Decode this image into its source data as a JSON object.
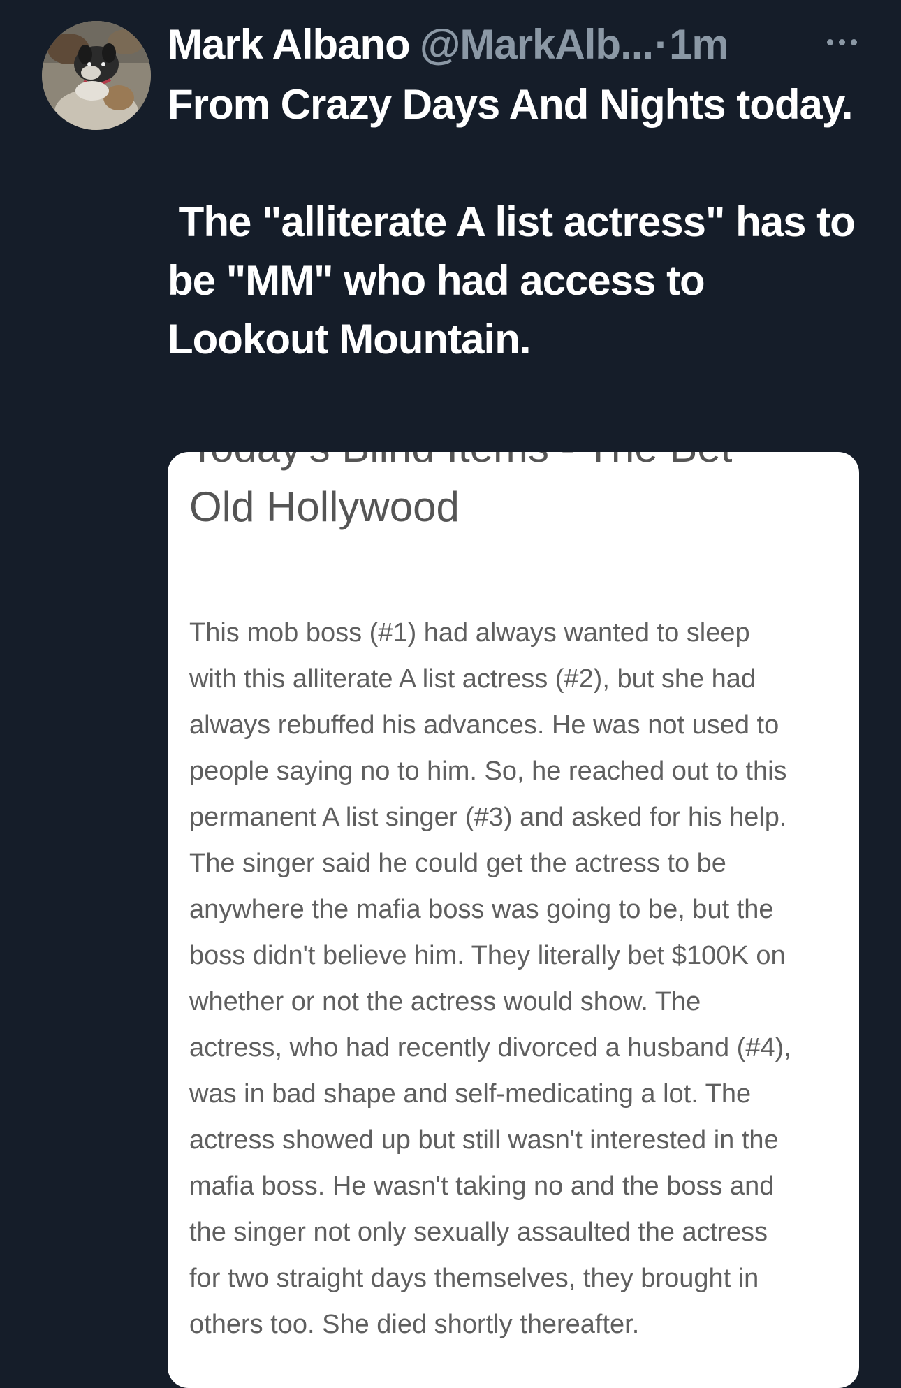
{
  "tweet": {
    "author_name": "Mark Albano",
    "author_handle": "@MarkAlb...",
    "separator": "·",
    "timestamp": "1m",
    "avatar_icon": "dog-avatar-icon",
    "more_icon": "more-horizontal-icon",
    "text_para1": "From Crazy Days And Nights today.",
    "text_para2": " The \"alliterate A list actress\" has to be \"MM\" who had access to Lookout Mountain."
  },
  "media": {
    "clipped_title": "Today's Blind Items - The Bet",
    "title": "Old Hollywood",
    "body_lines": [
      "This mob boss (#1) had always wanted to sleep",
      "with this alliterate A list actress (#2), but she had",
      "always rebuffed his advances. He was not used to",
      "people saying no to him. So, he reached out to this",
      "permanent A list singer (#3) and asked for his help.",
      "The singer said he could get the actress to be",
      "anywhere the mafia boss was going to be, but the",
      "boss didn't believe him. They literally bet $100K on",
      "whether or not the actress would show. The",
      "actress, who had recently divorced a husband (#4),",
      "was in bad shape and self-medicating a lot. The",
      "actress showed up but still wasn't interested in the",
      "mafia boss. He wasn't taking no and the boss and",
      "the singer not only sexually assaulted the actress",
      "for two straight days themselves, they brought in",
      "others too. She died shortly thereafter."
    ]
  },
  "colors": {
    "background": "#151d29",
    "text_primary": "#ffffff",
    "text_secondary": "#8b98a5",
    "card_background": "#ffffff",
    "card_text": "#5f5f5f"
  }
}
